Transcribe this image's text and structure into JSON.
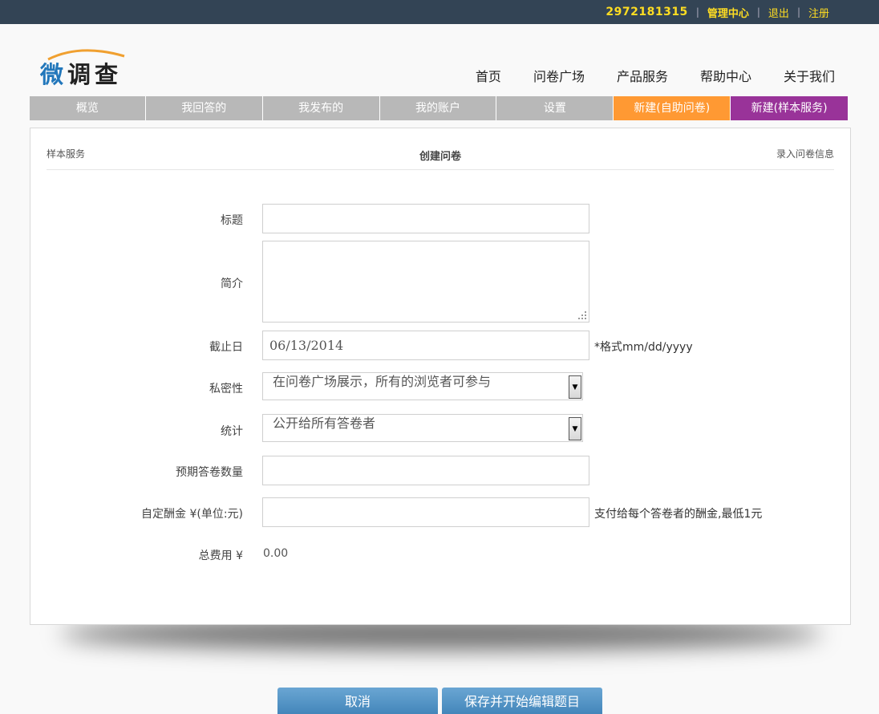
{
  "topbar": {
    "user_id": "2972181315",
    "admin_center": "管理中心",
    "logout": "退出",
    "register": "注册",
    "sep": "|"
  },
  "logo": {
    "char1": "微",
    "char2": "调",
    "char3": "查"
  },
  "mainnav": {
    "items": [
      "首页",
      "问卷广场",
      "产品服务",
      "帮助中心",
      "关于我们"
    ]
  },
  "tabs": {
    "items": [
      "概览",
      "我回答的",
      "我发布的",
      "我的账户",
      "设置",
      "新建(自助问卷)",
      "新建(样本服务)"
    ]
  },
  "panel": {
    "left": "样本服务",
    "title": "创建问卷",
    "right": "录入问卷信息"
  },
  "form": {
    "title_label": "标题",
    "title_value": "",
    "intro_label": "简介",
    "intro_value": "",
    "deadline_label": "截止日",
    "deadline_value": "06/13/2014",
    "deadline_hint": "*格式mm/dd/yyyy",
    "privacy_label": "私密性",
    "privacy_value": "在问卷广场展示，所有的浏览者可参与",
    "stats_label": "统计",
    "stats_value": "公开给所有答卷者",
    "expected_label": "预期答卷数量",
    "expected_value": "",
    "reward_label": "自定酬金 ¥(单位:元)",
    "reward_value": "",
    "reward_hint": "支付给每个答卷者的酬金,最低1元",
    "total_label": "总费用 ¥",
    "total_value": "0.00"
  },
  "buttons": {
    "cancel": "取消",
    "save": "保存并开始编辑题目"
  },
  "colors": {
    "topbar": "#334455",
    "accent_yellow": "#ffdd22",
    "tab_orange": "#ff9933",
    "tab_purple": "#993399",
    "button_blue": "#4a8fc4"
  }
}
